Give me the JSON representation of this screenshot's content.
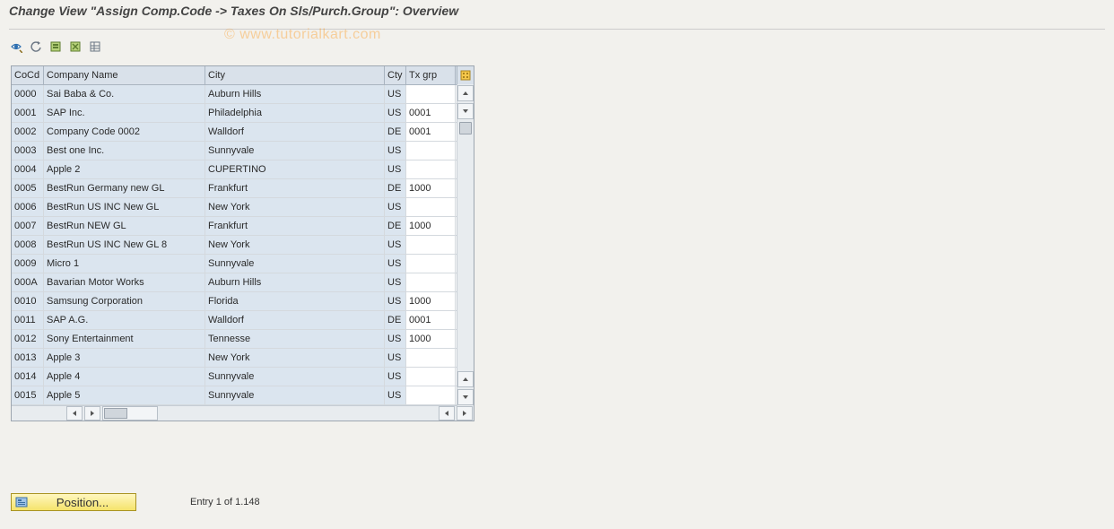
{
  "title": "Change View \"Assign Comp.Code -> Taxes On Sls/Purch.Group\": Overview",
  "watermark": "© www.tutorialkart.com",
  "columns": {
    "cocd": "CoCd",
    "name": "Company Name",
    "city": "City",
    "cty": "Cty",
    "txgrp": "Tx grp"
  },
  "rows": [
    {
      "cocd": "0000",
      "name": "Sai Baba & Co.",
      "city": "Auburn Hills",
      "cty": "US",
      "txgrp": ""
    },
    {
      "cocd": "0001",
      "name": "SAP Inc.",
      "city": "Philadelphia",
      "cty": "US",
      "txgrp": "0001"
    },
    {
      "cocd": "0002",
      "name": "Company Code 0002",
      "city": "Walldorf",
      "cty": "DE",
      "txgrp": "0001"
    },
    {
      "cocd": "0003",
      "name": "Best one Inc.",
      "city": "Sunnyvale",
      "cty": "US",
      "txgrp": ""
    },
    {
      "cocd": "0004",
      "name": "Apple 2",
      "city": "CUPERTINO",
      "cty": "US",
      "txgrp": ""
    },
    {
      "cocd": "0005",
      "name": "BestRun Germany new GL",
      "city": "Frankfurt",
      "cty": "DE",
      "txgrp": "1000"
    },
    {
      "cocd": "0006",
      "name": "BestRun US INC New GL",
      "city": "New York",
      "cty": "US",
      "txgrp": ""
    },
    {
      "cocd": "0007",
      "name": "BestRun NEW GL",
      "city": "Frankfurt",
      "cty": "DE",
      "txgrp": "1000"
    },
    {
      "cocd": "0008",
      "name": "BestRun US INC New GL 8",
      "city": "New York",
      "cty": "US",
      "txgrp": ""
    },
    {
      "cocd": "0009",
      "name": "Micro 1",
      "city": "Sunnyvale",
      "cty": "US",
      "txgrp": ""
    },
    {
      "cocd": "000A",
      "name": "Bavarian Motor Works",
      "city": "Auburn Hills",
      "cty": "US",
      "txgrp": ""
    },
    {
      "cocd": "0010",
      "name": "Samsung Corporation",
      "city": "Florida",
      "cty": "US",
      "txgrp": "1000"
    },
    {
      "cocd": "0011",
      "name": "SAP A.G.",
      "city": "Walldorf",
      "cty": "DE",
      "txgrp": "0001"
    },
    {
      "cocd": "0012",
      "name": "Sony Entertainment",
      "city": "Tennesse",
      "cty": "US",
      "txgrp": "1000"
    },
    {
      "cocd": "0013",
      "name": "Apple 3",
      "city": "New York",
      "cty": "US",
      "txgrp": ""
    },
    {
      "cocd": "0014",
      "name": "Apple 4",
      "city": "Sunnyvale",
      "cty": "US",
      "txgrp": ""
    },
    {
      "cocd": "0015",
      "name": "Apple 5",
      "city": "Sunnyvale",
      "cty": "US",
      "txgrp": ""
    }
  ],
  "footer": {
    "position_btn": "Position...",
    "entry": "Entry 1 of 1.148"
  }
}
